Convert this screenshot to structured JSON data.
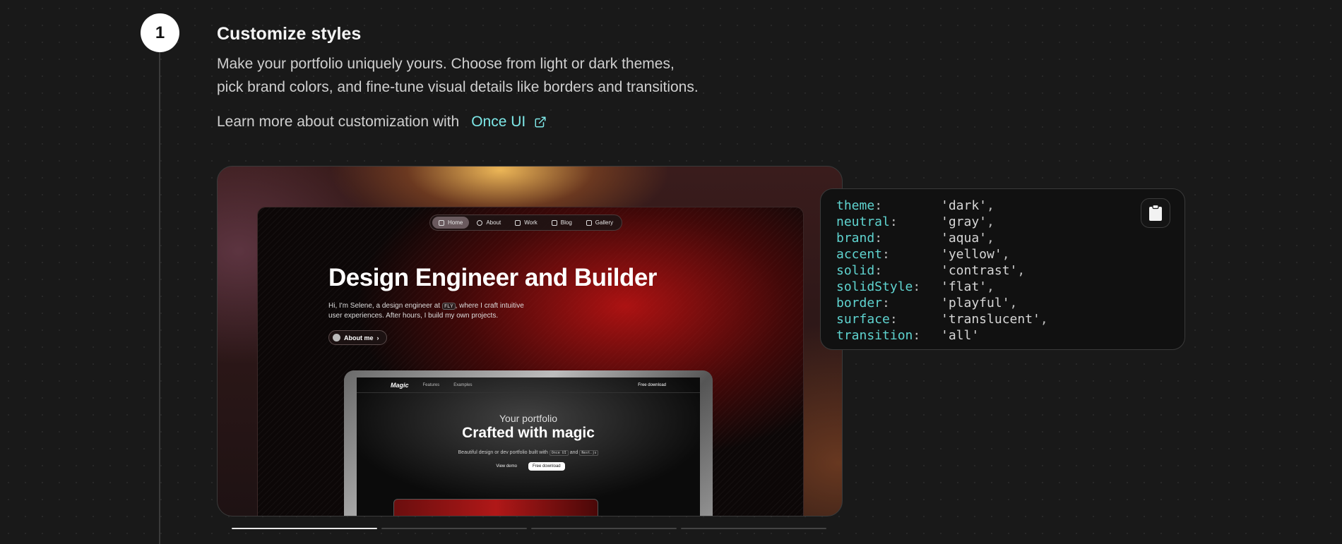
{
  "step": {
    "number": "1",
    "title": "Customize styles",
    "description_line1": "Make your portfolio uniquely yours. Choose from light or dark themes,",
    "description_line2": "pick brand colors, and fine-tune visual details like borders and transitions.",
    "learn_more_text": "Learn more about customization with",
    "learn_more_link": "Once UI"
  },
  "preview": {
    "nav": [
      "Home",
      "About",
      "Work",
      "Blog",
      "Gallery"
    ],
    "hero_title": "Design Engineer and Builder",
    "hero_sub_1": "Hi, I'm Selene, a design engineer at",
    "hero_sub_chip": "FLY",
    "hero_sub_2": ", where I craft intuitive",
    "hero_sub_3": "user experiences. After hours, I build my own projects.",
    "about_button": "About me",
    "laptop": {
      "brand": "Magic",
      "nav_features": "Features",
      "nav_examples": "Examples",
      "nav_free": "Free download",
      "kicker": "Your portfolio",
      "headline": "Crafted with magic",
      "small_text": "Beautiful design or dev portfolio built with",
      "chip1": "Once UI",
      "and": "and",
      "chip2": "Next.js",
      "btn_demo": "View demo",
      "btn_free": "Free download"
    },
    "carousel_active_index": 0,
    "carousel_count": 4
  },
  "code": [
    {
      "key": "theme",
      "value": "'dark'",
      "comma": ","
    },
    {
      "key": "neutral",
      "value": "'gray'",
      "comma": ","
    },
    {
      "key": "brand",
      "value": "'aqua'",
      "comma": ","
    },
    {
      "key": "accent",
      "value": "'yellow'",
      "comma": ","
    },
    {
      "key": "solid",
      "value": "'contrast'",
      "comma": ","
    },
    {
      "key": "solidStyle",
      "value": "'flat'",
      "comma": ","
    },
    {
      "key": "border",
      "value": "'playful'",
      "comma": ","
    },
    {
      "key": "surface",
      "value": "'translucent'",
      "comma": ","
    },
    {
      "key": "transition",
      "value": "'all'",
      "comma": ""
    }
  ],
  "icons": {
    "external_link": "external-link-icon",
    "copy": "clipboard-icon"
  },
  "colors": {
    "accent_link": "#7ee8e8",
    "code_key": "#5fd4d0",
    "background": "#191919"
  }
}
